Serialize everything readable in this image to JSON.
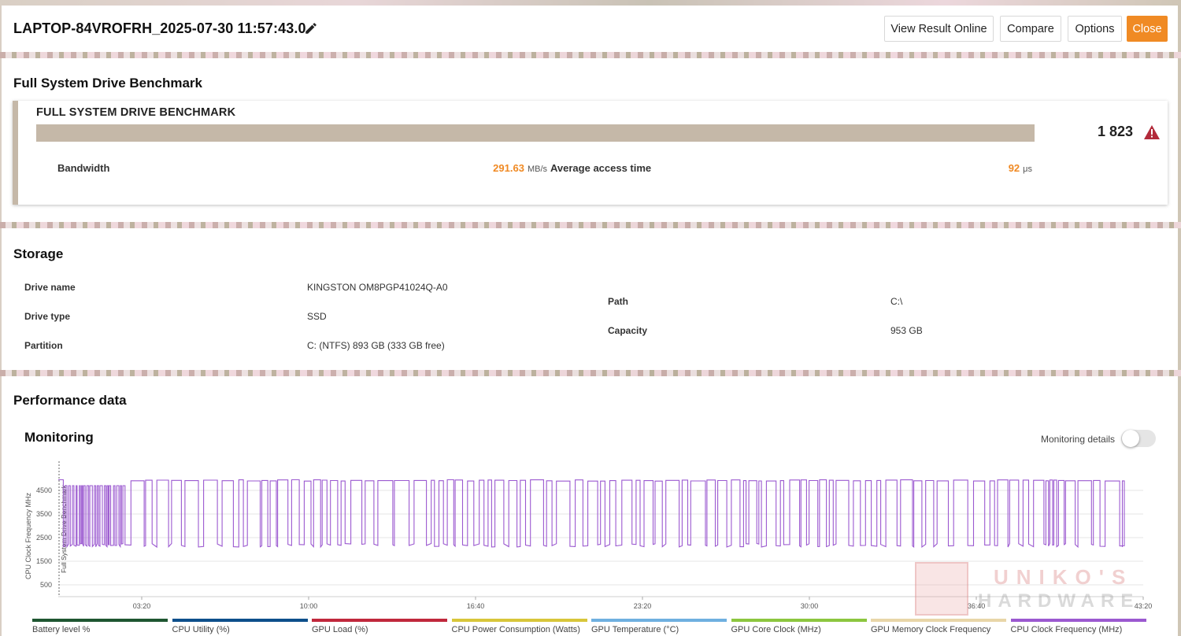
{
  "header": {
    "title": "LAPTOP-84VROFRH_2025-07-30 11:57:43.0",
    "buttons": {
      "view_online": "View Result Online",
      "compare": "Compare",
      "options": "Options",
      "close": "Close"
    }
  },
  "benchmark": {
    "section_title": "Full System Drive Benchmark",
    "card_title": "FULL SYSTEM DRIVE BENCHMARK",
    "score": "1 823",
    "bandwidth_label": "Bandwidth",
    "bandwidth_value": "291.63",
    "bandwidth_unit": "MB/s",
    "access_label": "Average access time",
    "access_value": "92",
    "access_unit": "μs"
  },
  "storage": {
    "section_title": "Storage",
    "rows": [
      {
        "label": "Drive name",
        "value": "KINGSTON OM8PGP41024Q-A0"
      },
      {
        "label": "Drive type",
        "value": "SSD"
      },
      {
        "label": "Partition",
        "value": "C: (NTFS) 893 GB (333 GB free)"
      },
      {
        "label": "Path",
        "value": "C:\\"
      },
      {
        "label": "Capacity",
        "value": "953 GB"
      }
    ]
  },
  "performance": {
    "section_title": "Performance data",
    "monitoring_title": "Monitoring",
    "monitoring_details_label": "Monitoring details",
    "monitoring_details_on": false
  },
  "legend": [
    {
      "name": "Battery level %",
      "color": "#1e5631"
    },
    {
      "name": "CPU Utility (%)",
      "color": "#0d4f8b"
    },
    {
      "name": "GPU Load (%)",
      "color": "#c0283c"
    },
    {
      "name": "CPU Power Consumption (Watts)",
      "color": "#d8c63a"
    },
    {
      "name": "GPU Temperature (°C)",
      "color": "#6fb0e0"
    },
    {
      "name": "GPU Core Clock (MHz)",
      "color": "#8cc63f"
    },
    {
      "name": "GPU Memory Clock Frequency",
      "color": "#e8d6a8"
    },
    {
      "name": "CPU Clock Frequency (MHz)",
      "color": "#9b59d0"
    }
  ],
  "watermark": {
    "line1": "UNIKO'S",
    "line2": "HARDWARE"
  },
  "colors": {
    "accent": "#f08a24",
    "bar": "#c5b8a8",
    "series": "#9b59d0"
  },
  "chart_data": {
    "type": "line",
    "ylabel": "CPU Clock Frequency MHz",
    "marker_label": "Full System Drive Benchmark",
    "y_ticks": [
      500,
      1500,
      2500,
      3500,
      4500
    ],
    "ylim": [
      0,
      5400
    ],
    "x_ticks": [
      "03:20",
      "10:00",
      "16:40",
      "23:20",
      "30:00",
      "36:40",
      "43:20"
    ],
    "x_tick_seconds": [
      200,
      600,
      1000,
      1400,
      1800,
      2200,
      2600
    ],
    "xlim_seconds": [
      0,
      2600
    ],
    "grid": true,
    "series": [
      {
        "name": "CPU Clock Frequency (MHz)",
        "high_value": 4950,
        "low_value": 2100,
        "sampled_seconds": [
          0,
          20,
          40,
          60,
          80,
          100,
          140,
          180,
          200,
          260,
          320,
          380,
          440,
          500,
          560,
          620,
          680,
          740,
          800,
          860,
          920,
          980,
          1040,
          1100,
          1160,
          1220,
          1280,
          1340,
          1400,
          1460,
          1520,
          1580,
          1640,
          1700,
          1760,
          1820,
          1880,
          1940,
          2000,
          2060,
          2120,
          2180,
          2240,
          2300,
          2340,
          2380,
          2420,
          2480,
          2540,
          2550
        ],
        "sampled_values": [
          4950,
          4950,
          2100,
          4700,
          2100,
          4700,
          2100,
          4700,
          4950,
          2100,
          4950,
          2100,
          4950,
          2100,
          4950,
          2100,
          4950,
          2100,
          4950,
          2100,
          4950,
          2100,
          4950,
          2100,
          4950,
          2100,
          4950,
          2100,
          4950,
          2100,
          4950,
          2100,
          4950,
          2100,
          4950,
          2100,
          4950,
          2100,
          4950,
          2100,
          4950,
          2100,
          4950,
          2100,
          4950,
          2100,
          4950,
          2100,
          4950,
          2100
        ]
      }
    ]
  }
}
